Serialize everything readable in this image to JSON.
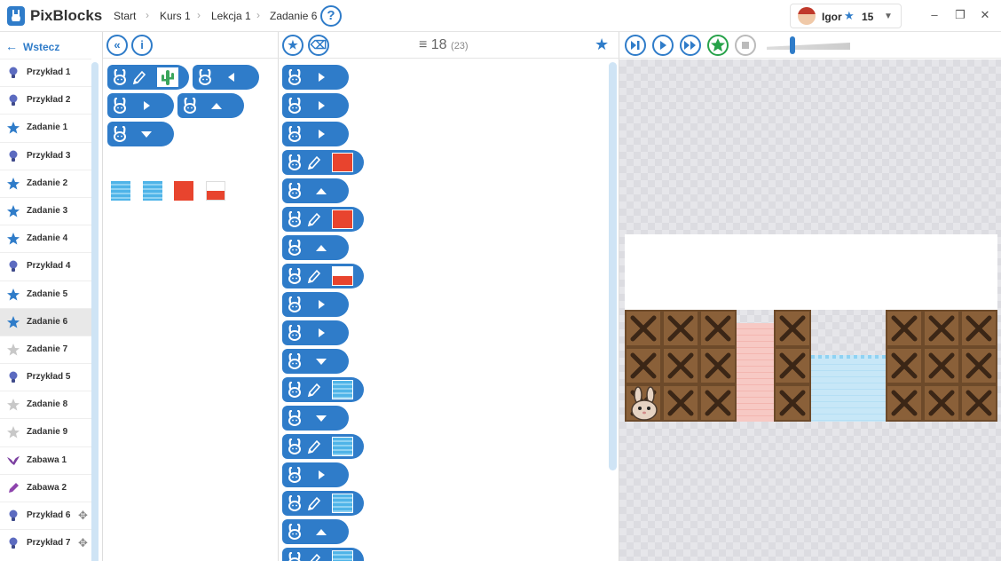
{
  "app": {
    "title": "PixBlocks"
  },
  "breadcrumb": [
    "Start",
    "Kurs 1",
    "Lekcja 1",
    "Zadanie 6"
  ],
  "help_icon": "?",
  "user": {
    "name": "Igor",
    "score": "15"
  },
  "window": {
    "minimize": "–",
    "maximize": "❐",
    "close": "✕"
  },
  "sidebar": {
    "back_label": "Wstecz",
    "items": [
      {
        "label": "Przykład 1",
        "icon": "bulb-icon"
      },
      {
        "label": "Przykład 2",
        "icon": "bulb-icon"
      },
      {
        "label": "Zadanie 1",
        "icon": "star-icon"
      },
      {
        "label": "Przykład 3",
        "icon": "bulb-icon"
      },
      {
        "label": "Zadanie 2",
        "icon": "star-icon"
      },
      {
        "label": "Zadanie 3",
        "icon": "star-icon"
      },
      {
        "label": "Zadanie 4",
        "icon": "star-icon"
      },
      {
        "label": "Przykład 4",
        "icon": "bulb-icon"
      },
      {
        "label": "Zadanie 5",
        "icon": "star-icon"
      },
      {
        "label": "Zadanie 6",
        "icon": "star-icon",
        "active": true
      },
      {
        "label": "Zadanie 7",
        "icon": "star-grey-icon"
      },
      {
        "label": "Przykład 5",
        "icon": "bulb-icon"
      },
      {
        "label": "Zadanie 8",
        "icon": "star-grey-icon"
      },
      {
        "label": "Zadanie 9",
        "icon": "star-grey-icon"
      },
      {
        "label": "Zabawa 1",
        "icon": "bird-icon"
      },
      {
        "label": "Zabawa 2",
        "icon": "pencil-icon"
      },
      {
        "label": "Przykład 6",
        "icon": "bulb-icon",
        "movable": true
      },
      {
        "label": "Przykład 7",
        "icon": "bulb-icon",
        "movable": true
      }
    ]
  },
  "palette": {
    "collapse_icon": "«",
    "info_icon": "i",
    "blocks": [
      {
        "type": "paint",
        "tile": "cactus"
      },
      {
        "type": "move",
        "dir": "left"
      },
      {
        "type": "move",
        "dir": "right"
      },
      {
        "type": "move",
        "dir": "up"
      },
      {
        "type": "move",
        "dir": "down"
      }
    ],
    "tiles": [
      "water",
      "water-wave",
      "red",
      "half-red"
    ]
  },
  "program": {
    "count": "18",
    "total": "(23)",
    "blocks": [
      {
        "type": "move",
        "dir": "right"
      },
      {
        "type": "move",
        "dir": "right"
      },
      {
        "type": "move",
        "dir": "right"
      },
      {
        "type": "paint",
        "tile": "red"
      },
      {
        "type": "move",
        "dir": "up"
      },
      {
        "type": "paint",
        "tile": "red"
      },
      {
        "type": "move",
        "dir": "up"
      },
      {
        "type": "paint",
        "tile": "half"
      },
      {
        "type": "move",
        "dir": "right"
      },
      {
        "type": "move",
        "dir": "right"
      },
      {
        "type": "move",
        "dir": "down"
      },
      {
        "type": "paint",
        "tile": "water"
      },
      {
        "type": "move",
        "dir": "down"
      },
      {
        "type": "paint",
        "tile": "water"
      },
      {
        "type": "move",
        "dir": "right"
      },
      {
        "type": "paint",
        "tile": "water"
      },
      {
        "type": "move",
        "dir": "up"
      },
      {
        "type": "paint",
        "tile": "water"
      }
    ]
  },
  "stage": {
    "speed": 0.3,
    "zoom_out": "−",
    "zoom_in": "+"
  },
  "colors": {
    "accent": "#2f7cc9",
    "green": "#27a24a",
    "red": "#e8442e",
    "crate": "#8a6039"
  }
}
